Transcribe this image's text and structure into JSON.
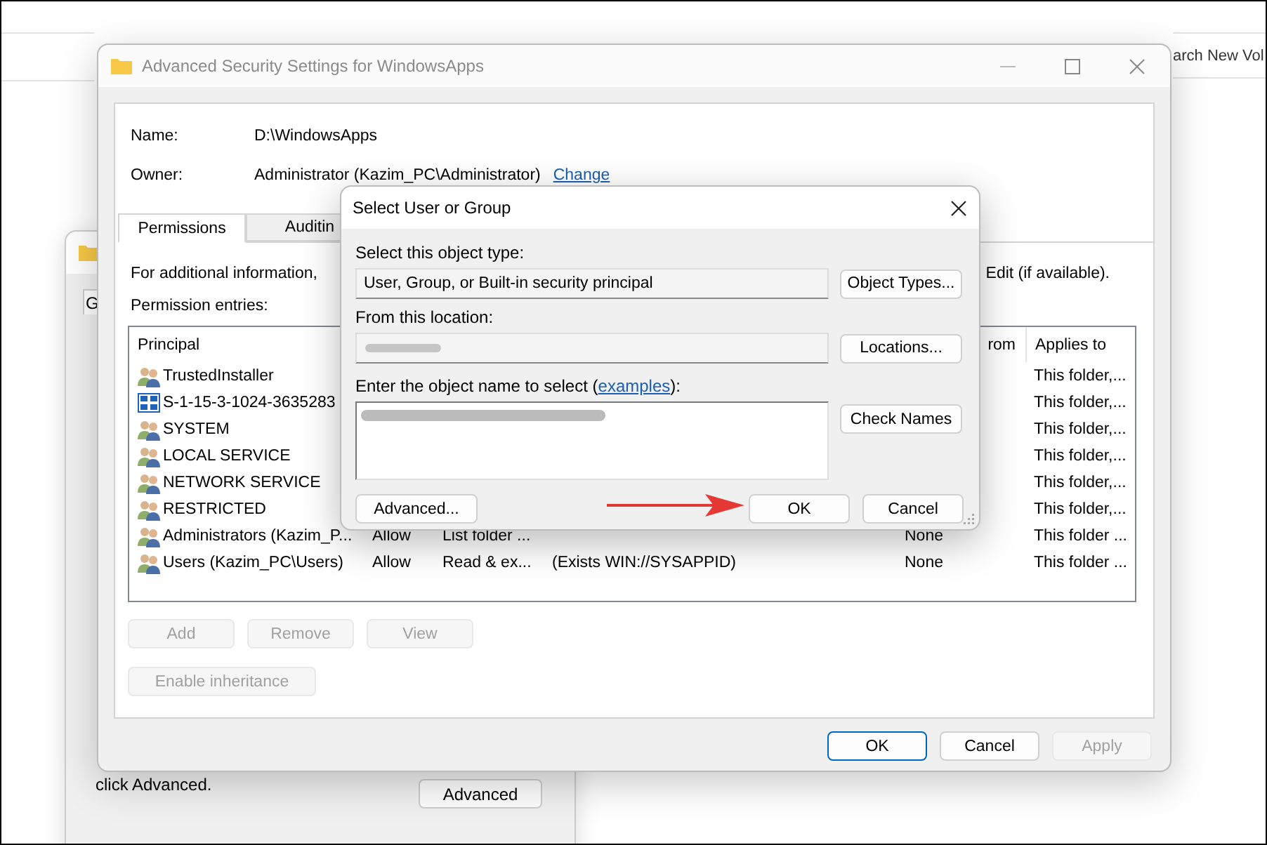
{
  "explorer": {
    "search_text": "arch New Vol"
  },
  "back_window": {
    "tab": "G",
    "note": "click Advanced.",
    "button": "Advanced"
  },
  "main_window": {
    "title": "Advanced Security Settings for WindowsApps",
    "info": [
      {
        "label": "Name:",
        "value": "D:\\WindowsApps"
      },
      {
        "label": "Owner:",
        "value": "Administrator (Kazim_PC\\Administrator)",
        "link": "Change"
      }
    ],
    "tabs": [
      {
        "label": "Permissions",
        "selected": true
      },
      {
        "label": "Auditin",
        "selected": false
      }
    ],
    "info_text": "For additional information,",
    "info_text_end": "Edit (if available).",
    "entries_label": "Permission entries:",
    "table": {
      "header": {
        "principal": "Principal",
        "inherited_from": "rom",
        "applies_to": "Applies to"
      },
      "rows": [
        {
          "kind": "group",
          "principal": "TrustedInstaller",
          "applies_to": "This folder,..."
        },
        {
          "kind": "package",
          "principal": "S-1-15-3-1024-3635283",
          "applies_to": "This folder,..."
        },
        {
          "kind": "group",
          "principal": "SYSTEM",
          "applies_to": "This folder,..."
        },
        {
          "kind": "group",
          "principal": "LOCAL SERVICE",
          "applies_to": "This folder,..."
        },
        {
          "kind": "group",
          "principal": "NETWORK SERVICE",
          "applies_to": "This folder,..."
        },
        {
          "kind": "group",
          "principal": "RESTRICTED",
          "applies_to": "This folder,..."
        },
        {
          "kind": "group",
          "principal": "Administrators (Kazim_P...",
          "type": "Allow",
          "access": "List folder ...",
          "inherited_from": "None",
          "applies_to": "This folder ..."
        },
        {
          "kind": "group",
          "principal": "Users (Kazim_PC\\Users)",
          "type": "Allow",
          "access": "Read & ex...",
          "condition": "(Exists WIN://SYSAPPID)",
          "inherited_from": "None",
          "applies_to": "This folder ..."
        }
      ]
    },
    "entry_buttons": [
      {
        "label": "Add",
        "disabled": true
      },
      {
        "label": "Remove",
        "disabled": true
      },
      {
        "label": "View",
        "disabled": true
      }
    ],
    "inheritance_button": {
      "label": "Enable inheritance",
      "disabled": true
    },
    "footer_buttons": [
      {
        "label": "OK",
        "default": true,
        "disabled": false
      },
      {
        "label": "Cancel",
        "default": false,
        "disabled": false
      },
      {
        "label": "Apply",
        "default": false,
        "disabled": true
      }
    ]
  },
  "dialog": {
    "title": "Select User or Group",
    "type_label": "Select this object type:",
    "type_value": "User, Group, or Built-in security principal",
    "object_types_button": "Object Types...",
    "location_label": "From this location:",
    "location_redacted": true,
    "locations_button": "Locations...",
    "name_label": "Enter the object name to select (",
    "name_link": "examples",
    "name_label_end": "):",
    "name_redacted": true,
    "check_names_button": "Check Names",
    "advanced_button": "Advanced...",
    "buttons": [
      {
        "label": "OK",
        "default": false
      },
      {
        "label": "Cancel",
        "default": false
      }
    ]
  }
}
